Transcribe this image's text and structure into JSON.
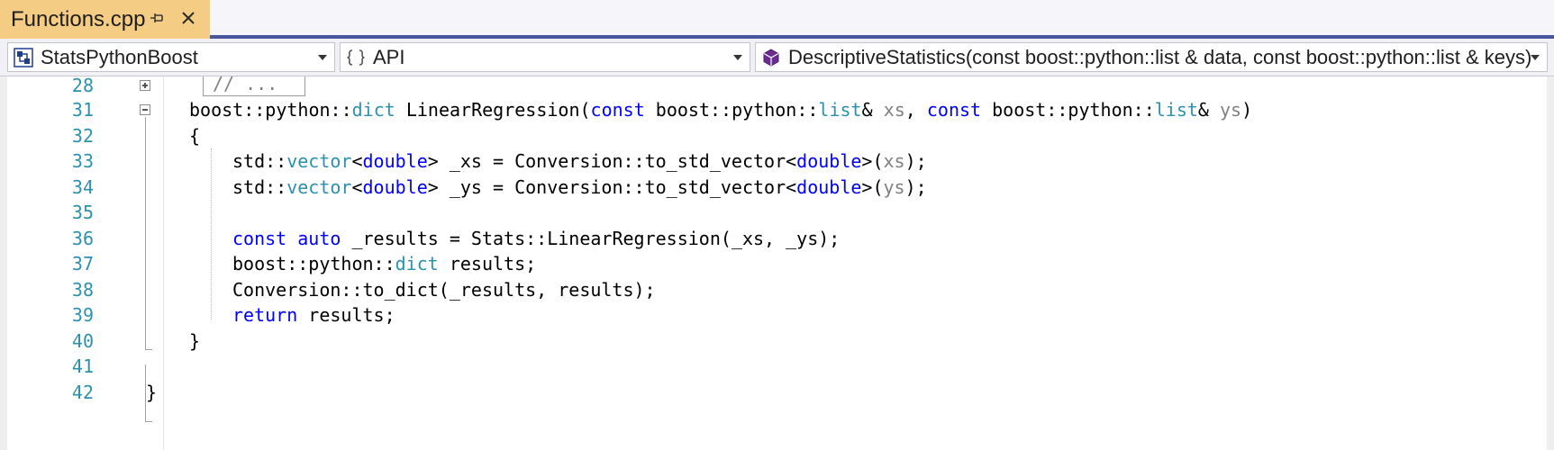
{
  "tab": {
    "title": "Functions.cpp",
    "pin_icon": "pin-icon",
    "close_icon": "close-icon"
  },
  "navbar": {
    "project": "StatsPythonBoost",
    "scope": "API",
    "member": "DescriptiveStatistics(const boost::python::list & data, const boost::python::list & keys)"
  },
  "editor": {
    "lines": [
      {
        "number": "28",
        "text": "// ..."
      },
      {
        "number": "31",
        "text": "boost::python::dict LinearRegression(const boost::python::list& xs, const boost::python::list& ys)"
      },
      {
        "number": "32",
        "text": "{"
      },
      {
        "number": "33",
        "text": "std::vector<double> _xs = Conversion::to_std_vector<double>(xs);"
      },
      {
        "number": "34",
        "text": "std::vector<double> _ys = Conversion::to_std_vector<double>(ys);"
      },
      {
        "number": "35",
        "text": ""
      },
      {
        "number": "36",
        "text": "const auto _results = Stats::LinearRegression(_xs, _ys);"
      },
      {
        "number": "37",
        "text": "boost::python::dict results;"
      },
      {
        "number": "38",
        "text": "Conversion::to_dict(_results, results);"
      },
      {
        "number": "39",
        "text": "return results;"
      },
      {
        "number": "40",
        "text": "}"
      },
      {
        "number": "41",
        "text": ""
      },
      {
        "number": "42",
        "text": "}"
      }
    ]
  },
  "colors": {
    "keyword": "#0000ff",
    "type": "#2b91af",
    "parameter": "#808080",
    "comment": "#008000",
    "line_number": "#2b91af",
    "active_tab": "#f5cc84",
    "tab_accent": "#4a55a0"
  }
}
